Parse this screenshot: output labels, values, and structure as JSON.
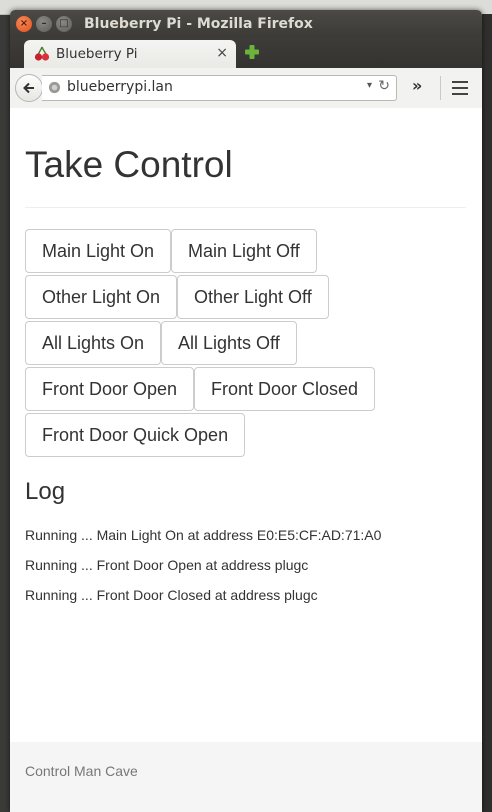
{
  "window": {
    "title": "Blueberry Pi - Mozilla Firefox",
    "close_glyph": "×",
    "min_glyph": "–",
    "max_glyph": "□"
  },
  "tab": {
    "title": "Blueberry Pi",
    "close_glyph": "×",
    "icon": "cherry-favicon-icon"
  },
  "newtab": {
    "icon": "plus-icon",
    "color": "#6cb33e"
  },
  "navbar": {
    "url": "blueberrypi.lan",
    "dropdown_glyph": "▾",
    "reload_glyph": "↻",
    "overflow_glyph": "»"
  },
  "page": {
    "title": "Take Control",
    "buttons": [
      "Main Light On",
      "Main Light Off",
      "Other Light On",
      "Other Light Off",
      "All Lights On",
      "All Lights Off",
      "Front Door Open",
      "Front Door Closed",
      "Front Door Quick Open"
    ],
    "log_heading": "Log",
    "log_lines": [
      "Running ... Main Light On at address E0:E5:CF:AD:71:A0",
      "Running ... Front Door Open at address plugc",
      "Running ... Front Door Closed at address plugc"
    ],
    "footer": "Control Man Cave"
  },
  "colors": {
    "titlebar": "#3b3a36",
    "close_button": "#e0501c",
    "text": "#333333",
    "footer_bg": "#f5f5f5"
  }
}
